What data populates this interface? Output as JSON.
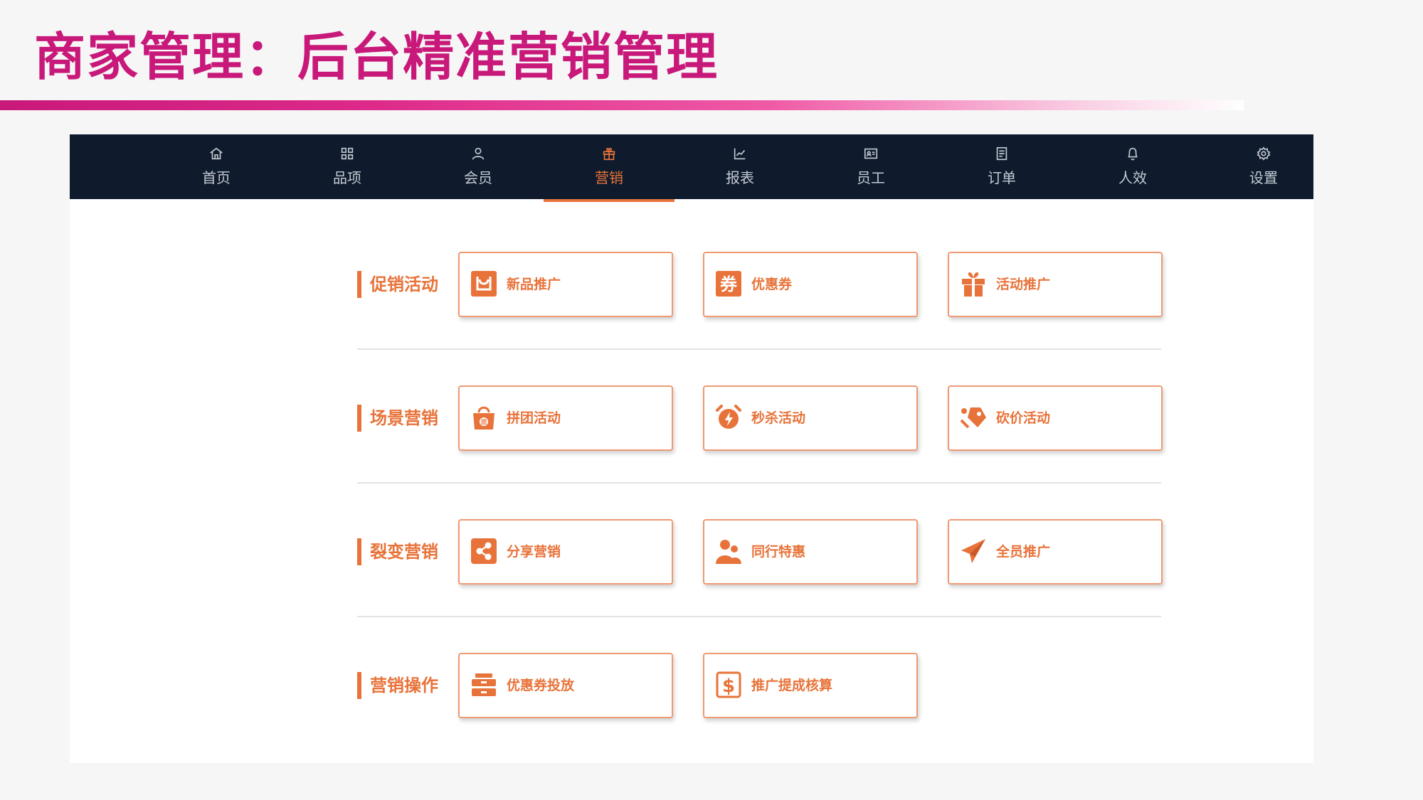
{
  "slide": {
    "title": "商家管理：后台精准营销管理"
  },
  "colors": {
    "title": "#c8197a",
    "nav_bg": "#0f1b2d",
    "accent": "#e8733a",
    "tile_border": "#ee9a73"
  },
  "nav": {
    "items": [
      {
        "label": "首页",
        "icon": "home-icon"
      },
      {
        "label": "品项",
        "icon": "grid-icon"
      },
      {
        "label": "会员",
        "icon": "user-icon"
      },
      {
        "label": "营销",
        "icon": "gift-icon",
        "active": true
      },
      {
        "label": "报表",
        "icon": "line-chart-icon"
      },
      {
        "label": "员工",
        "icon": "id-card-icon"
      },
      {
        "label": "订单",
        "icon": "document-icon"
      },
      {
        "label": "人效",
        "icon": "bell-icon"
      },
      {
        "label": "设置",
        "icon": "gear-icon"
      }
    ]
  },
  "sections": [
    {
      "title": "促销活动",
      "tiles": [
        {
          "label": "新品推广",
          "icon": "shopping-bag-icon"
        },
        {
          "label": "优惠券",
          "icon": "coupon-icon"
        },
        {
          "label": "活动推广",
          "icon": "gift-box-icon"
        }
      ]
    },
    {
      "title": "场景营销",
      "tiles": [
        {
          "label": "拼团活动",
          "icon": "group-bag-icon"
        },
        {
          "label": "秒杀活动",
          "icon": "alarm-clock-icon"
        },
        {
          "label": "砍价活动",
          "icon": "price-tag-icon"
        }
      ]
    },
    {
      "title": "裂变营销",
      "tiles": [
        {
          "label": "分享营销",
          "icon": "share-icon"
        },
        {
          "label": "同行特惠",
          "icon": "people-icon"
        },
        {
          "label": "全员推广",
          "icon": "paper-plane-icon"
        }
      ]
    },
    {
      "title": "营销操作",
      "tiles": [
        {
          "label": "优惠券投放",
          "icon": "coupon-stack-icon"
        },
        {
          "label": "推广提成核算",
          "icon": "dollar-icon"
        }
      ]
    }
  ]
}
